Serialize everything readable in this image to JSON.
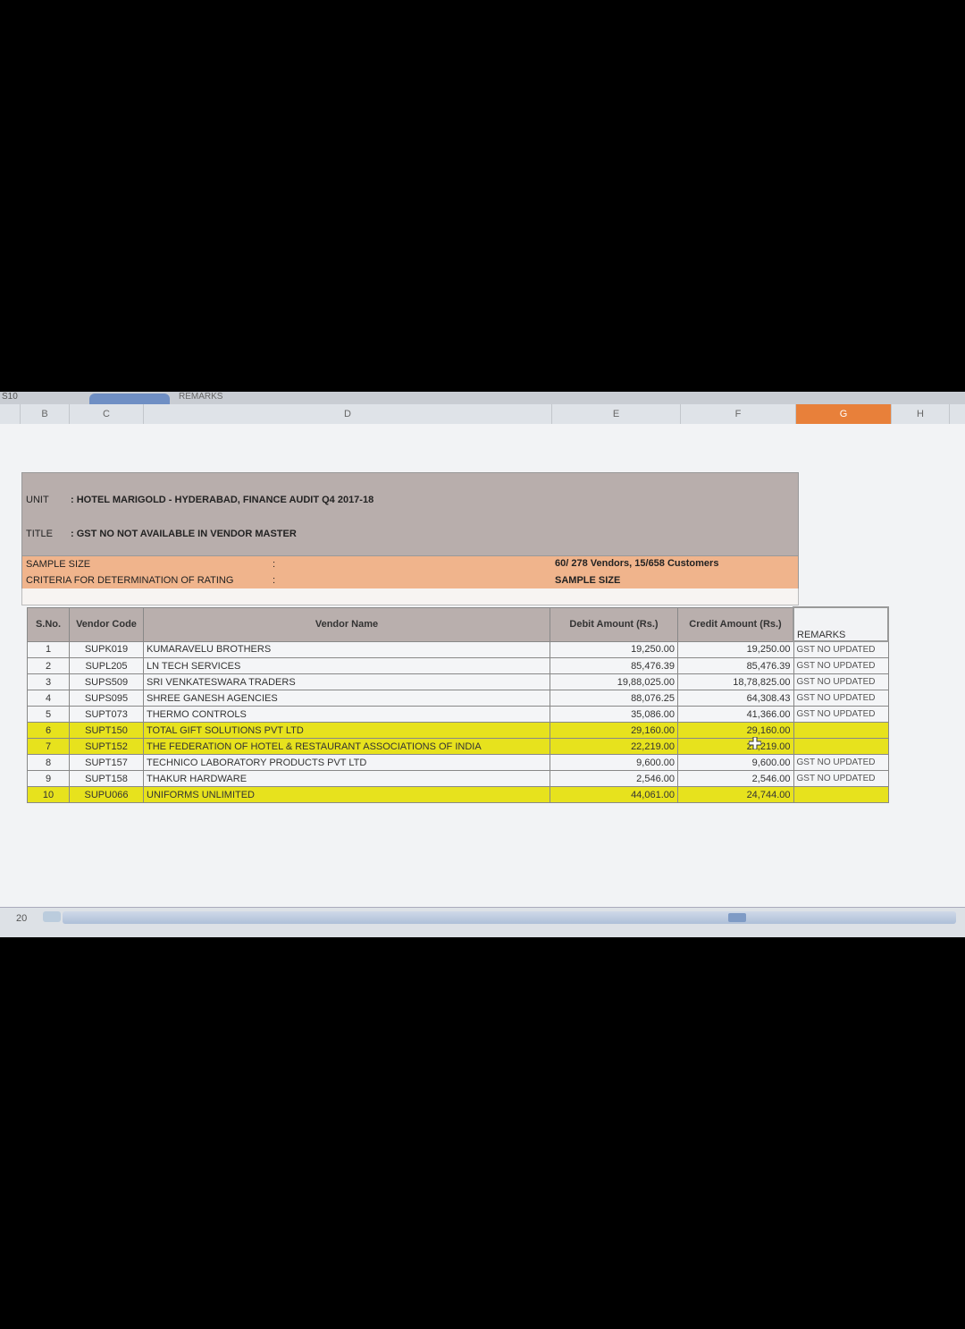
{
  "topstrip": {
    "cell_ref": "S10",
    "remarks_hint": "REMARKS"
  },
  "columns": [
    "B",
    "C",
    "D",
    "E",
    "F",
    "G",
    "H"
  ],
  "header": {
    "unit_label": "UNIT",
    "unit_value": ": HOTEL MARIGOLD - HYDERABAD, FINANCE AUDIT Q4 2017-18",
    "title_label": "TITLE",
    "title_value": ": GST NO NOT AVAILABLE IN VENDOR MASTER",
    "sample_label": "SAMPLE SIZE",
    "sample_colon": ":",
    "sample_value": "60/ 278 Vendors, 15/658 Customers",
    "criteria_label": "CRITERIA FOR DETERMINATION OF RATING",
    "criteria_colon": ":",
    "criteria_value": "SAMPLE SIZE"
  },
  "table": {
    "headers": {
      "sno": "S.No.",
      "code": "Vendor Code",
      "name": "Vendor Name",
      "debit": "Debit Amount (Rs.)",
      "credit": "Credit Amount (Rs.)",
      "remarks": "REMARKS"
    },
    "rows": [
      {
        "sno": "1",
        "code": "SUPK019",
        "name": "KUMARAVELU BROTHERS",
        "debit": "19,250.00",
        "credit": "19,250.00",
        "remarks": "GST NO UPDATED",
        "highlight": false
      },
      {
        "sno": "2",
        "code": "SUPL205",
        "name": "LN TECH SERVICES",
        "debit": "85,476.39",
        "credit": "85,476.39",
        "remarks": "GST NO UPDATED",
        "highlight": false
      },
      {
        "sno": "3",
        "code": "SUPS509",
        "name": "SRI VENKATESWARA TRADERS",
        "debit": "19,88,025.00",
        "credit": "18,78,825.00",
        "remarks": "GST NO UPDATED",
        "highlight": false
      },
      {
        "sno": "4",
        "code": "SUPS095",
        "name": "SHREE GANESH AGENCIES",
        "debit": "88,076.25",
        "credit": "64,308.43",
        "remarks": "GST NO UPDATED",
        "highlight": false
      },
      {
        "sno": "5",
        "code": "SUPT073",
        "name": "THERMO CONTROLS",
        "debit": "35,086.00",
        "credit": "41,366.00",
        "remarks": "GST NO UPDATED",
        "highlight": false
      },
      {
        "sno": "6",
        "code": "SUPT150",
        "name": "TOTAL GIFT SOLUTIONS PVT LTD",
        "debit": "29,160.00",
        "credit": "29,160.00",
        "remarks": "",
        "highlight": true
      },
      {
        "sno": "7",
        "code": "SUPT152",
        "name": "THE FEDERATION OF HOTEL & RESTAURANT ASSOCIATIONS OF INDIA",
        "debit": "22,219.00",
        "credit": "22,219.00",
        "remarks": "",
        "highlight": true
      },
      {
        "sno": "8",
        "code": "SUPT157",
        "name": "TECHNICO LABORATORY PRODUCTS PVT LTD",
        "debit": "9,600.00",
        "credit": "9,600.00",
        "remarks": "GST NO UPDATED",
        "highlight": false
      },
      {
        "sno": "9",
        "code": "SUPT158",
        "name": "THAKUR HARDWARE",
        "debit": "2,546.00",
        "credit": "2,546.00",
        "remarks": "GST NO UPDATED",
        "highlight": false
      },
      {
        "sno": "10",
        "code": "SUPU066",
        "name": "UNIFORMS UNLIMITED",
        "debit": "44,061.00",
        "credit": "24,744.00",
        "remarks": "",
        "highlight": true
      }
    ]
  },
  "footer": {
    "row_number": "20"
  },
  "colors": {
    "header_band": "#b8aeac",
    "sample_band": "#f0b48c",
    "highlight": "#e7e21d",
    "selected_column": "#e8803a"
  }
}
